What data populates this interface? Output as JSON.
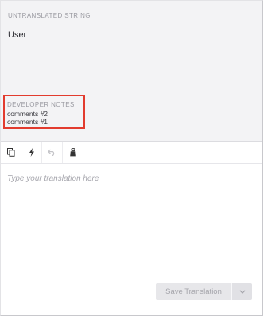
{
  "source": {
    "section_label": "UNTRANSLATED STRING",
    "text": "User"
  },
  "developer_notes": {
    "title": "DEVELOPER NOTES",
    "lines": [
      "comments #2",
      "comments #1"
    ]
  },
  "toolbar": {
    "tools": [
      "copy-icon",
      "lightning-icon",
      "undo-icon",
      "glossary-icon"
    ]
  },
  "translation": {
    "placeholder": "Type your translation here",
    "value": ""
  },
  "actions": {
    "save_label": "Save Translation",
    "dropdown_icon": "chevron-down-icon"
  },
  "colors": {
    "highlight_border": "#e23b2e",
    "source_panel_bg": "#f3f3f5",
    "button_bg": "#e7e7ea"
  }
}
